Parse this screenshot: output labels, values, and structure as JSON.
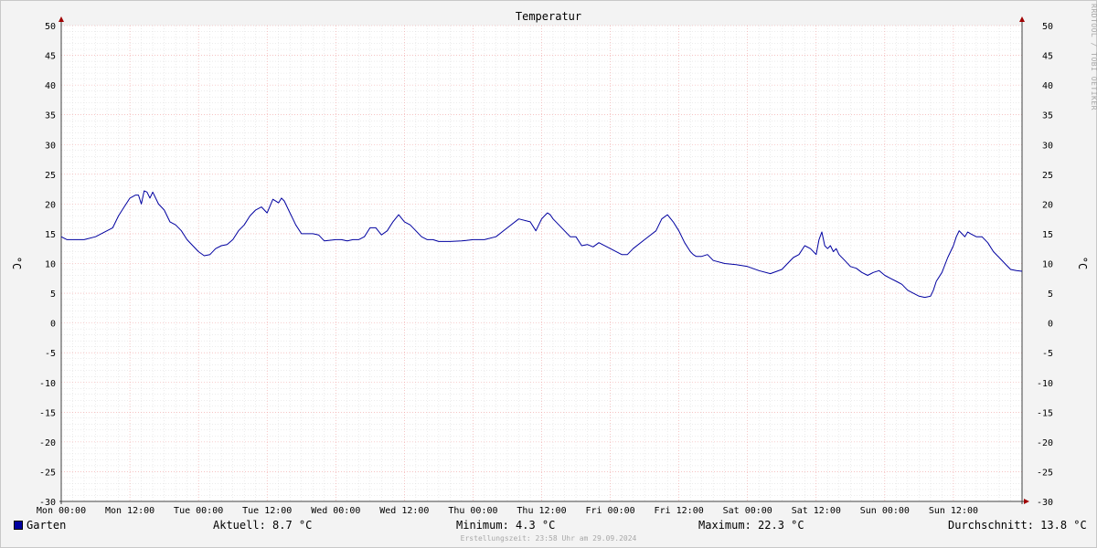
{
  "watermark": "RRDTOOL / TOBI OETIKER",
  "legend": {
    "series_name": "Garten",
    "series_color": "#0000a0",
    "current": "Aktuell: 8.7 °C",
    "minimum": "Minimum: 4.3 °C",
    "maximum": "Maximum: 22.3 °C",
    "average": "Durchschnitt: 13.8 °C"
  },
  "footer": "Erstellungszeit: 23:58 Uhr am 29.09.2024",
  "chart_data": {
    "type": "line",
    "title": "Temperatur",
    "ylabel": "°C",
    "ylabel_right": "°C",
    "ylim": [
      -30,
      50
    ],
    "yticks": [
      50,
      45,
      40,
      35,
      30,
      25,
      20,
      15,
      10,
      5,
      0,
      -5,
      -10,
      -15,
      -20,
      -25,
      -30
    ],
    "xlim": [
      0,
      168
    ],
    "xticks": [
      {
        "x": 0,
        "label": "Mon 00:00"
      },
      {
        "x": 12,
        "label": "Mon 12:00"
      },
      {
        "x": 24,
        "label": "Tue 00:00"
      },
      {
        "x": 36,
        "label": "Tue 12:00"
      },
      {
        "x": 48,
        "label": "Wed 00:00"
      },
      {
        "x": 60,
        "label": "Wed 12:00"
      },
      {
        "x": 72,
        "label": "Thu 00:00"
      },
      {
        "x": 84,
        "label": "Thu 12:00"
      },
      {
        "x": 96,
        "label": "Fri 00:00"
      },
      {
        "x": 108,
        "label": "Fri 12:00"
      },
      {
        "x": 120,
        "label": "Sat 00:00"
      },
      {
        "x": 132,
        "label": "Sat 12:00"
      },
      {
        "x": 144,
        "label": "Sun 00:00"
      },
      {
        "x": 156,
        "label": "Sun 12:00"
      }
    ],
    "grid": true,
    "series": [
      {
        "name": "Garten",
        "color": "#0000a0",
        "x": [
          0,
          1,
          4,
          6,
          8,
          9,
          10,
          11,
          12,
          13,
          13.5,
          14,
          14.5,
          15,
          15.5,
          16,
          17,
          18,
          19,
          20,
          21,
          22,
          23,
          24,
          25,
          26,
          27,
          28,
          29,
          30,
          31,
          32,
          33,
          34,
          35,
          36,
          37,
          38,
          38.5,
          39,
          39.5,
          40,
          40.5,
          41,
          42,
          43,
          44,
          45,
          46,
          48,
          49,
          50,
          51,
          52,
          53,
          54,
          55,
          56,
          57,
          58,
          59,
          60,
          61,
          62,
          63,
          64,
          65,
          66,
          68,
          70,
          72,
          74,
          76,
          78,
          80,
          82,
          83,
          84,
          84.5,
          85,
          85.5,
          86,
          87,
          88,
          89,
          90,
          91,
          92,
          93,
          94,
          96,
          98,
          99,
          100,
          102,
          104,
          105,
          106,
          107,
          108,
          109,
          110,
          110.5,
          111,
          112,
          113,
          114,
          116,
          118,
          120,
          122,
          124,
          126,
          127,
          128,
          129,
          130,
          131,
          132,
          132.5,
          133,
          133.5,
          134,
          134.5,
          135,
          135.5,
          136,
          137,
          138,
          139,
          140,
          141,
          142,
          143,
          144,
          145,
          146,
          147,
          148,
          149,
          150,
          151,
          152,
          152.5,
          153,
          154,
          155,
          156,
          156.5,
          157,
          157.5,
          158,
          158.5,
          159,
          160,
          161,
          162,
          163,
          164,
          165,
          166,
          167,
          168
        ],
        "values": [
          14.5,
          14.0,
          14.0,
          14.5,
          15.5,
          16.0,
          18.0,
          19.5,
          21.0,
          21.5,
          21.5,
          20.0,
          22.2,
          22.0,
          21.0,
          22.0,
          20.0,
          19.0,
          17.0,
          16.5,
          15.5,
          14.0,
          13.0,
          12.0,
          11.3,
          11.5,
          12.5,
          13.0,
          13.2,
          14.0,
          15.5,
          16.5,
          18.0,
          19.0,
          19.5,
          18.5,
          20.8,
          20.2,
          21.0,
          20.5,
          19.5,
          18.5,
          17.5,
          16.5,
          15.0,
          15.0,
          15.0,
          14.8,
          13.8,
          14.0,
          14.0,
          13.8,
          14.0,
          14.0,
          14.5,
          16.0,
          16.0,
          14.8,
          15.5,
          17.0,
          18.2,
          17.0,
          16.5,
          15.5,
          14.5,
          14.0,
          14.0,
          13.7,
          13.7,
          13.8,
          14.0,
          14.0,
          14.5,
          16.0,
          17.5,
          17.0,
          15.5,
          17.5,
          18.0,
          18.5,
          18.2,
          17.5,
          16.5,
          15.5,
          14.5,
          14.5,
          13.0,
          13.2,
          12.8,
          13.5,
          12.5,
          11.5,
          11.5,
          12.5,
          14.0,
          15.5,
          17.5,
          18.2,
          17.0,
          15.5,
          13.5,
          12.0,
          11.5,
          11.2,
          11.2,
          11.5,
          10.5,
          10.0,
          9.8,
          9.5,
          8.8,
          8.3,
          9.0,
          10.0,
          11.0,
          11.5,
          13.0,
          12.5,
          11.5,
          14.0,
          15.3,
          13.0,
          12.5,
          13.0,
          12.0,
          12.5,
          11.5,
          10.5,
          9.5,
          9.2,
          8.5,
          8.0,
          8.5,
          8.8,
          8.0,
          7.5,
          7.0,
          6.5,
          5.5,
          5.0,
          4.5,
          4.3,
          4.5,
          5.5,
          7.0,
          8.5,
          11.0,
          13.0,
          14.5,
          15.5,
          15.0,
          14.5,
          15.3,
          15.0,
          14.5,
          14.5,
          13.5,
          12.0,
          11.0,
          10.0,
          9.0,
          8.8,
          8.7
        ]
      }
    ]
  }
}
